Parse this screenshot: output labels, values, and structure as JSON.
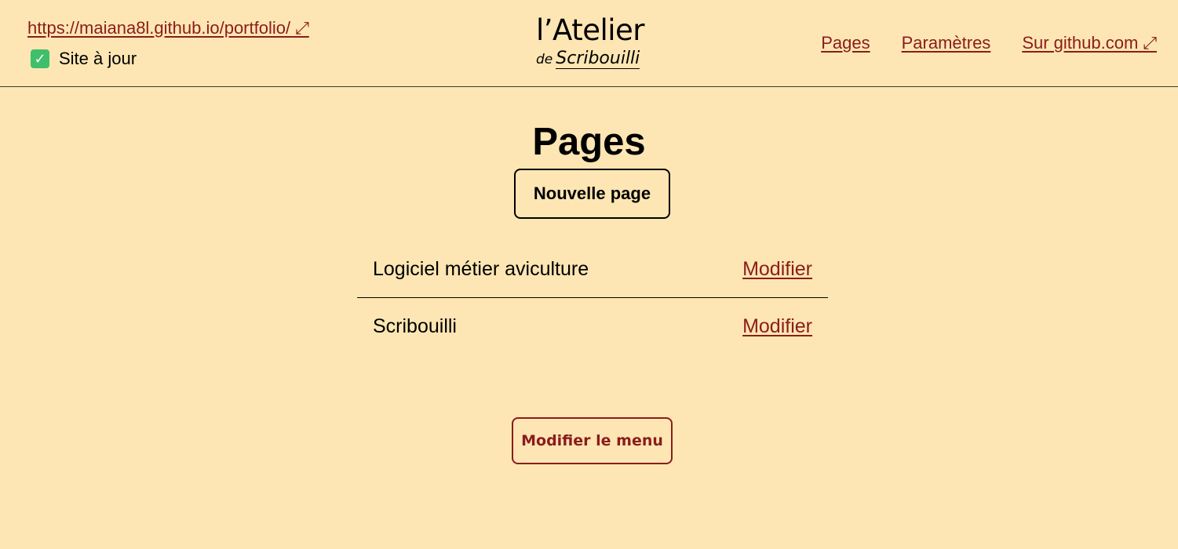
{
  "header": {
    "site_url": "https://maiana8l.github.io/portfolio/ ⤢",
    "status_text": "Site à jour",
    "status_icon": "check-icon",
    "logo": {
      "main": "l’Atelier",
      "sub_prefix": "de",
      "sub_name": "Scribouilli"
    },
    "nav": {
      "pages": "Pages",
      "settings": "Paramètres",
      "github": "Sur github.com ⤢"
    }
  },
  "main": {
    "title": "Pages",
    "new_page_label": "Nouvelle page",
    "pages": [
      {
        "name": "Logiciel métier aviculture",
        "edit_label": "Modifier"
      },
      {
        "name": "Scribouilli",
        "edit_label": "Modifier"
      }
    ],
    "edit_menu_label": "Modifier le menu"
  },
  "colors": {
    "background": "#fde6b3",
    "link": "#8b1c1c",
    "status_check": "#3fbf6a"
  }
}
